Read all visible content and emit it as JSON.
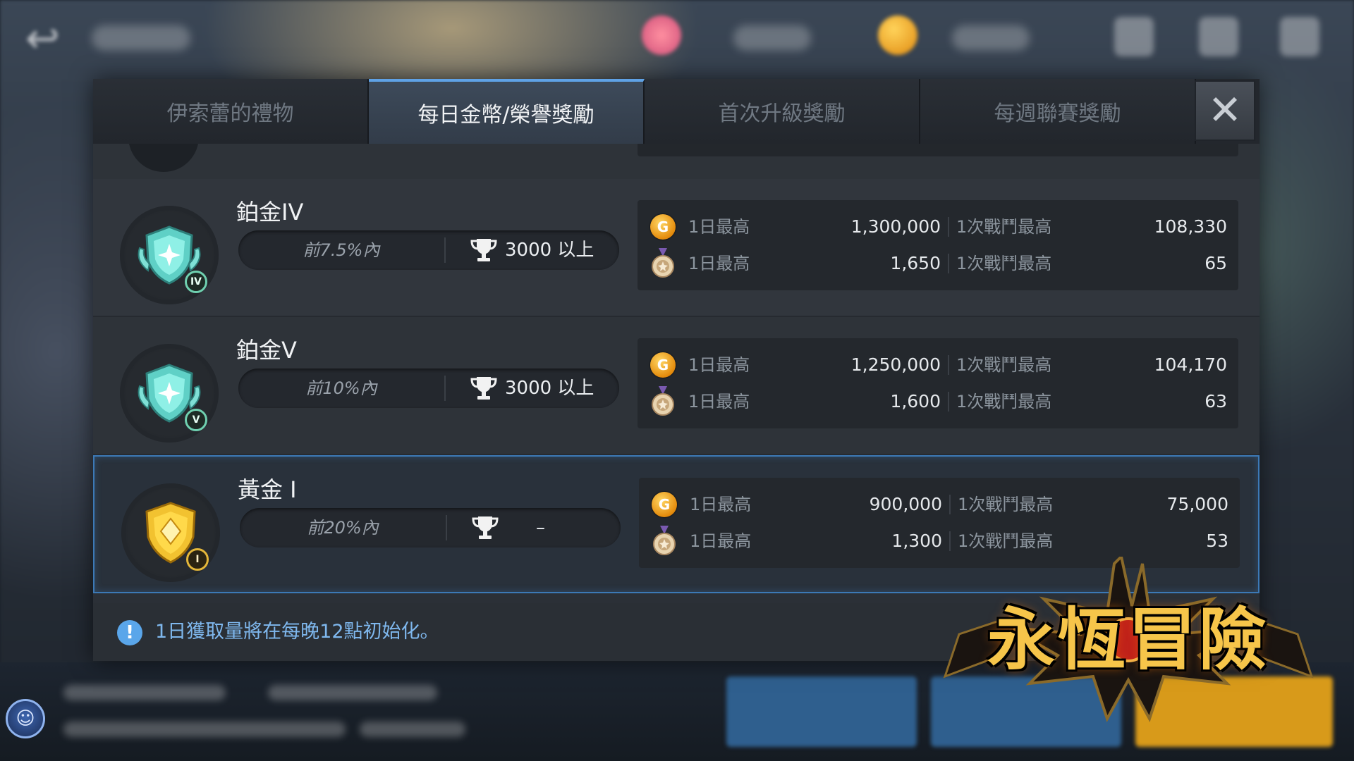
{
  "tabs": [
    {
      "label": "伊索蕾的禮物",
      "active": false
    },
    {
      "label": "每日金幣/榮譽獎勵",
      "active": true
    },
    {
      "label": "首次升級獎勵",
      "active": false
    },
    {
      "label": "每週聯賽獎勵",
      "active": false
    }
  ],
  "close_label": "✕",
  "tiers": [
    {
      "name": "鉑金IV",
      "level_badge": "IV",
      "badge_color": "platinum",
      "rank_condition": "前7.5%內",
      "score_condition": "3000 以上",
      "gold": {
        "daily_label": "1日最高",
        "daily_value": "1,300,000",
        "battle_label": "1次戰鬥最高",
        "battle_value": "108,330"
      },
      "honor": {
        "daily_label": "1日最高",
        "daily_value": "1,650",
        "battle_label": "1次戰鬥最高",
        "battle_value": "65"
      }
    },
    {
      "name": "鉑金V",
      "level_badge": "V",
      "badge_color": "platinum",
      "rank_condition": "前10%內",
      "score_condition": "3000 以上",
      "gold": {
        "daily_label": "1日最高",
        "daily_value": "1,250,000",
        "battle_label": "1次戰鬥最高",
        "battle_value": "104,170"
      },
      "honor": {
        "daily_label": "1日最高",
        "daily_value": "1,600",
        "battle_label": "1次戰鬥最高",
        "battle_value": "63"
      }
    },
    {
      "name": "黃金 I",
      "level_badge": "I",
      "badge_color": "gold",
      "rank_condition": "前20%內",
      "score_condition": "–",
      "gold": {
        "daily_label": "1日最高",
        "daily_value": "900,000",
        "battle_label": "1次戰鬥最高",
        "battle_value": "75,000"
      },
      "honor": {
        "daily_label": "1日最高",
        "daily_value": "1,300",
        "battle_label": "1次戰鬥最高",
        "battle_value": "53"
      }
    }
  ],
  "highlighted_tier": "黃金 I",
  "notice": "1日獲取量將在每晚12點初始化。",
  "notice_icon": "!",
  "coin_glyph": "G",
  "logo_text": "永恆冒險",
  "colors": {
    "accent": "#5fa2e6",
    "highlight_border": "#3c79b6",
    "notice_text": "#7fb8ee",
    "platinum_badge": "#5fd0c6",
    "gold_badge": "#f2c230",
    "coin": "#f0a020"
  }
}
